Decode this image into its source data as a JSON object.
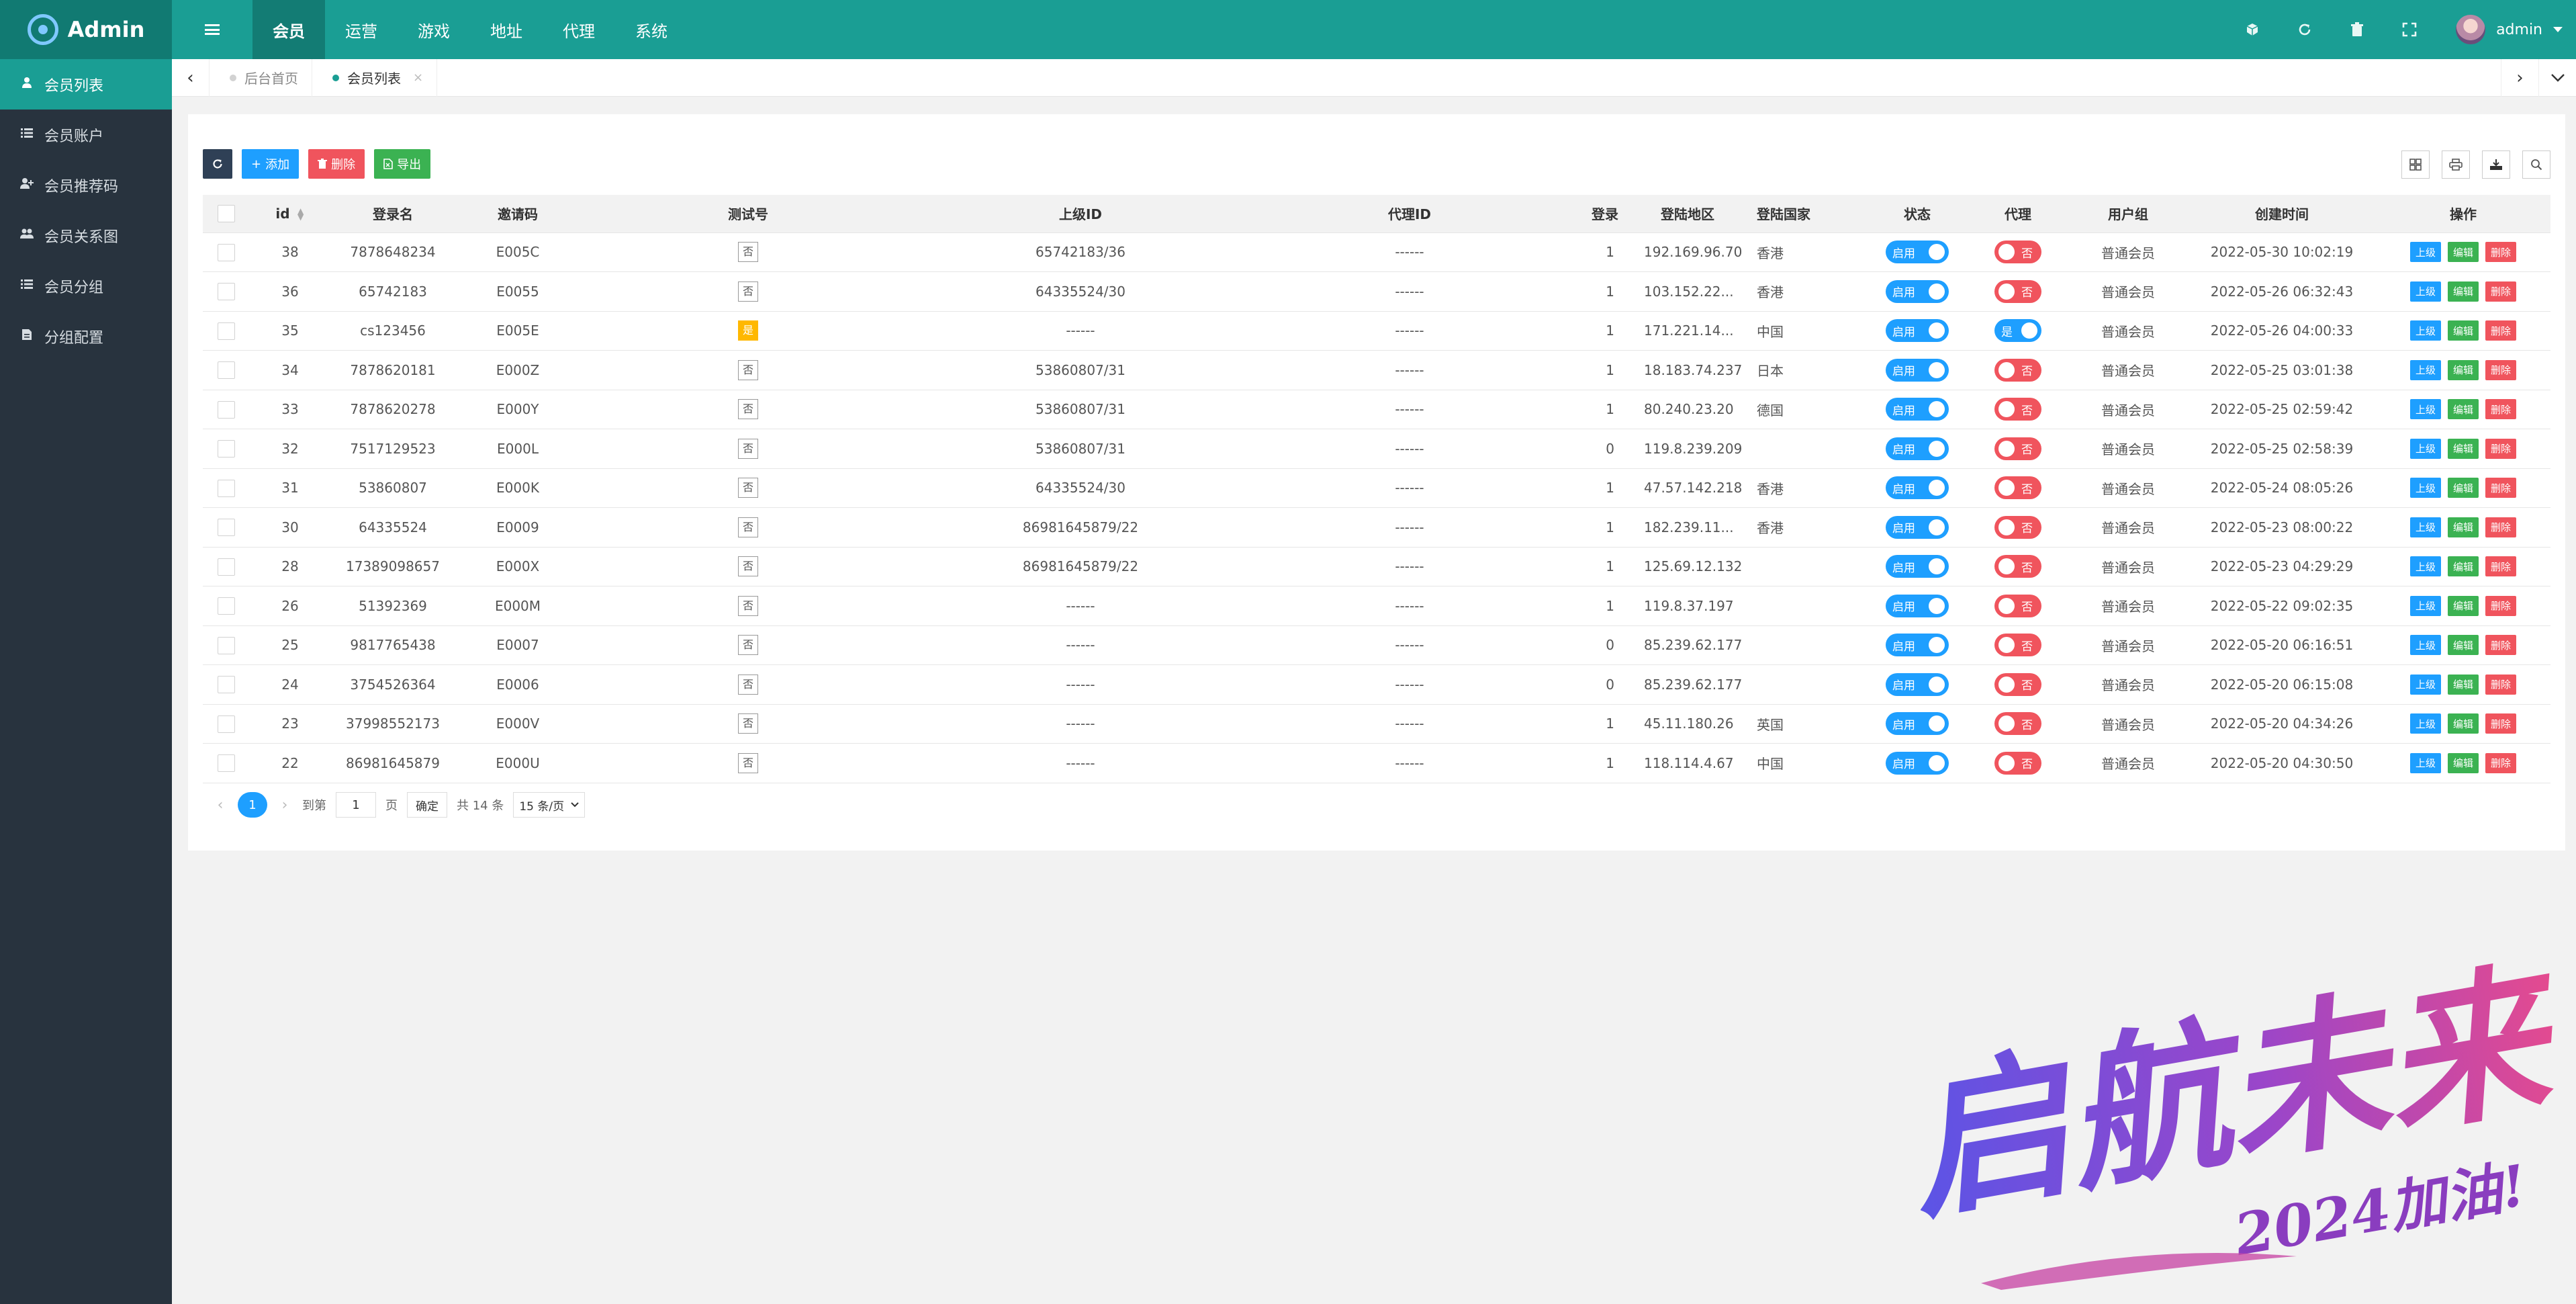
{
  "header": {
    "logo_text": "Admin",
    "nav": [
      "会员",
      "运营",
      "游戏",
      "地址",
      "代理",
      "系统"
    ],
    "active_nav": 0,
    "icons": [
      "cube-icon",
      "refresh-icon",
      "trash-icon",
      "fullscreen-icon"
    ],
    "user_name": "admin"
  },
  "sidebar": {
    "items": [
      {
        "label": "会员列表",
        "icon": "user-icon",
        "active": true
      },
      {
        "label": "会员账户",
        "icon": "list-icon",
        "active": false
      },
      {
        "label": "会员推荐码",
        "icon": "user-plus-icon",
        "active": false
      },
      {
        "label": "会员关系图",
        "icon": "users-icon",
        "active": false
      },
      {
        "label": "会员分组",
        "icon": "list-icon",
        "active": false
      },
      {
        "label": "分组配置",
        "icon": "file-icon",
        "active": false
      }
    ]
  },
  "tabs": [
    {
      "label": "后台首页",
      "active": false
    },
    {
      "label": "会员列表",
      "active": true
    }
  ],
  "toolbar": {
    "add_label": "添加",
    "delete_label": "删除",
    "export_label": "导出"
  },
  "table": {
    "columns": [
      "id",
      "登录名",
      "邀请码",
      "测试号",
      "上级ID",
      "代理ID",
      "登录",
      "登陆地区",
      "登陆国家",
      "状态",
      "代理",
      "用户组",
      "创建时间",
      "操作"
    ],
    "status_on_label": "启用",
    "agent_yes_label": "是",
    "agent_no_label": "否",
    "test_yes_label": "是",
    "test_no_label": "否",
    "op_labels": {
      "up": "上级",
      "edit": "编辑",
      "del": "删除"
    },
    "rows": [
      {
        "id": "38",
        "login": "7878648234",
        "code": "E005C",
        "test": "否",
        "parent": "65742183/36",
        "agent_id": "------",
        "logins": "1",
        "region": "192.169.96.70",
        "country": "香港",
        "agent": false,
        "group": "普通会员",
        "created": "2022-05-30 10:02:19"
      },
      {
        "id": "36",
        "login": "65742183",
        "code": "E0055",
        "test": "否",
        "parent": "64335524/30",
        "agent_id": "------",
        "logins": "1",
        "region": "103.152.22...",
        "country": "香港",
        "agent": false,
        "group": "普通会员",
        "created": "2022-05-26 06:32:43"
      },
      {
        "id": "35",
        "login": "cs123456",
        "code": "E005E",
        "test": "是",
        "parent": "------",
        "agent_id": "------",
        "logins": "1",
        "region": "171.221.14...",
        "country": "中国",
        "agent": true,
        "group": "普通会员",
        "created": "2022-05-26 04:00:33"
      },
      {
        "id": "34",
        "login": "7878620181",
        "code": "E000Z",
        "test": "否",
        "parent": "53860807/31",
        "agent_id": "------",
        "logins": "1",
        "region": "18.183.74.237",
        "country": "日本",
        "agent": false,
        "group": "普通会员",
        "created": "2022-05-25 03:01:38"
      },
      {
        "id": "33",
        "login": "7878620278",
        "code": "E000Y",
        "test": "否",
        "parent": "53860807/31",
        "agent_id": "------",
        "logins": "1",
        "region": "80.240.23.20",
        "country": "德国",
        "agent": false,
        "group": "普通会员",
        "created": "2022-05-25 02:59:42"
      },
      {
        "id": "32",
        "login": "7517129523",
        "code": "E000L",
        "test": "否",
        "parent": "53860807/31",
        "agent_id": "------",
        "logins": "0",
        "region": "119.8.239.209",
        "country": "",
        "agent": false,
        "group": "普通会员",
        "created": "2022-05-25 02:58:39"
      },
      {
        "id": "31",
        "login": "53860807",
        "code": "E000K",
        "test": "否",
        "parent": "64335524/30",
        "agent_id": "------",
        "logins": "1",
        "region": "47.57.142.218",
        "country": "香港",
        "agent": false,
        "group": "普通会员",
        "created": "2022-05-24 08:05:26"
      },
      {
        "id": "30",
        "login": "64335524",
        "code": "E0009",
        "test": "否",
        "parent": "86981645879/22",
        "agent_id": "------",
        "logins": "1",
        "region": "182.239.11...",
        "country": "香港",
        "agent": false,
        "group": "普通会员",
        "created": "2022-05-23 08:00:22"
      },
      {
        "id": "28",
        "login": "17389098657",
        "code": "E000X",
        "test": "否",
        "parent": "86981645879/22",
        "agent_id": "------",
        "logins": "1",
        "region": "125.69.12.132",
        "country": "",
        "agent": false,
        "group": "普通会员",
        "created": "2022-05-23 04:29:29"
      },
      {
        "id": "26",
        "login": "51392369",
        "code": "E000M",
        "test": "否",
        "parent": "------",
        "agent_id": "------",
        "logins": "1",
        "region": "119.8.37.197",
        "country": "",
        "agent": false,
        "group": "普通会员",
        "created": "2022-05-22 09:02:35"
      },
      {
        "id": "25",
        "login": "9817765438",
        "code": "E0007",
        "test": "否",
        "parent": "------",
        "agent_id": "------",
        "logins": "0",
        "region": "85.239.62.177",
        "country": "",
        "agent": false,
        "group": "普通会员",
        "created": "2022-05-20 06:16:51"
      },
      {
        "id": "24",
        "login": "3754526364",
        "code": "E0006",
        "test": "否",
        "parent": "------",
        "agent_id": "------",
        "logins": "0",
        "region": "85.239.62.177",
        "country": "",
        "agent": false,
        "group": "普通会员",
        "created": "2022-05-20 06:15:08"
      },
      {
        "id": "23",
        "login": "37998552173",
        "code": "E000V",
        "test": "否",
        "parent": "------",
        "agent_id": "------",
        "logins": "1",
        "region": "45.11.180.26",
        "country": "英国",
        "agent": false,
        "group": "普通会员",
        "created": "2022-05-20 04:34:26"
      },
      {
        "id": "22",
        "login": "86981645879",
        "code": "E000U",
        "test": "否",
        "parent": "------",
        "agent_id": "------",
        "logins": "1",
        "region": "118.114.4.67",
        "country": "中国",
        "agent": false,
        "group": "普通会员",
        "created": "2022-05-20 04:30:50"
      }
    ]
  },
  "pager": {
    "current": "1",
    "goto_label": "到第",
    "goto_value": "1",
    "page_unit": "页",
    "confirm_label": "确定",
    "total_label": "共 14 条",
    "page_size_label": "15 条/页"
  },
  "watermark": {
    "main_text": "启航未来",
    "sub_text": "2024加油!"
  },
  "colors": {
    "header": "#1a9e94",
    "sidebar": "#28333e",
    "primary_blue": "#1e9fff",
    "danger_red": "#f0545d",
    "success_green": "#3bb252",
    "warn_yellow": "#ffb800"
  }
}
